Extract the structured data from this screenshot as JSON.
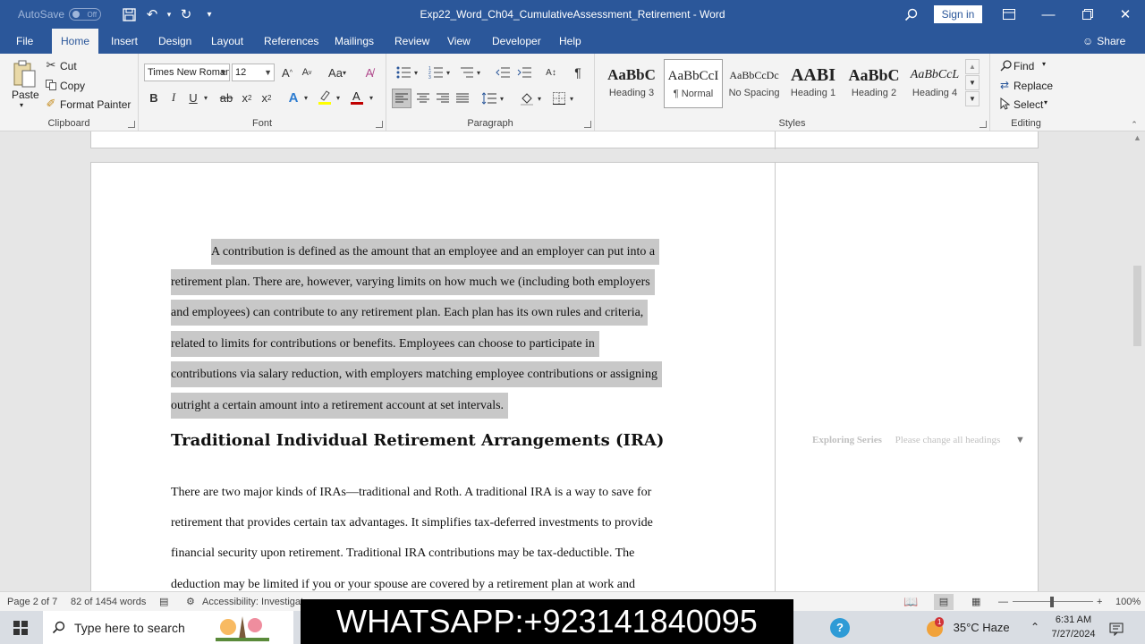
{
  "titlebar": {
    "autosave_label": "AutoSave",
    "autosave_state": "Off",
    "doc_title": "Exp22_Word_Ch04_CumulativeAssessment_Retirement  -  Word",
    "signin_label": "Sign in"
  },
  "tabs": [
    "File",
    "Home",
    "Insert",
    "Design",
    "Layout",
    "References",
    "Mailings",
    "Review",
    "View",
    "Developer",
    "Help"
  ],
  "active_tab": "Home",
  "share_label": "Share",
  "clipboard": {
    "paste": "Paste",
    "cut": "Cut",
    "copy": "Copy",
    "format_painter": "Format Painter",
    "label": "Clipboard"
  },
  "font": {
    "name": "Times New Roman",
    "size": "12",
    "label": "Font"
  },
  "paragraph": {
    "label": "Paragraph"
  },
  "styles": {
    "label": "Styles",
    "items": [
      {
        "sample": "AaBbC",
        "name": "Heading 3"
      },
      {
        "sample": "AaBbCcI",
        "name": "¶ Normal"
      },
      {
        "sample": "AaBbCcDc",
        "name": "No Spacing"
      },
      {
        "sample": "AABI",
        "name": "Heading 1"
      },
      {
        "sample": "AaBbC",
        "name": "Heading 2"
      },
      {
        "sample": "AaBbCcL",
        "name": "Heading 4"
      }
    ]
  },
  "editing": {
    "find": "Find",
    "replace": "Replace",
    "select": "Select",
    "label": "Editing"
  },
  "document": {
    "selected_lines": [
      "A contribution is defined as the amount that an employee and an employer can put into a",
      "retirement plan. There are, however, varying limits on how much we (including both employers",
      "and employees) can contribute to any retirement plan. Each plan has its own rules and criteria,",
      "related to limits for contributions or benefits. Employees can choose to participate in",
      "contributions via salary reduction, with employers matching employee contributions or assigning",
      "outright a certain amount into a retirement account at set intervals."
    ],
    "heading": "Traditional Individual Retirement Arrangements (IRA)",
    "body_lines": [
      "There are two major kinds of IRAs—traditional and Roth. A traditional IRA is a way to save for",
      "retirement that provides certain tax advantages. It simplifies tax-deferred investments to provide",
      "financial security upon retirement. Traditional IRA contributions may be tax-deductible. The",
      "deduction may be limited if you or your spouse are covered by a retirement plan at work and"
    ],
    "side_series": "Exploring Series",
    "side_note": "Please change all headings"
  },
  "statusbar": {
    "page": "Page 2 of 7",
    "words": "82 of 1454 words",
    "accessibility": "Accessibility: Investigat",
    "zoom": "100%"
  },
  "taskbar": {
    "search_placeholder": "Type here to search",
    "banner": "WHATSAPP:+923141840095",
    "weather": "35°C  Haze",
    "weather_badge": "1",
    "time": "6:31 AM",
    "date": "7/27/2024"
  }
}
